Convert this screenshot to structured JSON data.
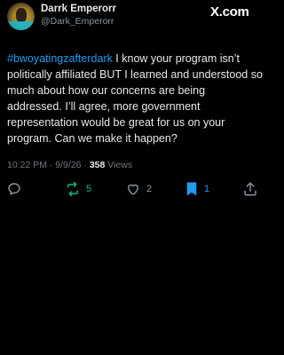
{
  "header": {
    "display_name": "Darrk Emperorr",
    "handle": "@Dark_Emperorr",
    "site_logo": "X.com"
  },
  "tweet": {
    "hashtag": "#bwoyatingzafterdark",
    "body": " I know your program isn’t politically affiliated BUT I learned and understood so much about how our concerns are being addressed. I’ll agree, more government representation would be great for us on your program. Can we make it happen?"
  },
  "meta": {
    "time": "10:22 PM",
    "separator": "·",
    "date": "9/9/26",
    "views_count": "358",
    "views_label": "Views"
  },
  "actions": {
    "retweet_count": "5",
    "like_count": "2",
    "bookmark_count": "1"
  },
  "colors": {
    "background": "#000000",
    "text": "#e7e9ea",
    "muted": "#71767b",
    "accent_blue": "#1d9bf0",
    "retweet_green": "#00ba7c"
  },
  "icons": [
    "reply-icon",
    "retweet-icon",
    "like-icon",
    "bookmark-icon",
    "share-icon"
  ]
}
